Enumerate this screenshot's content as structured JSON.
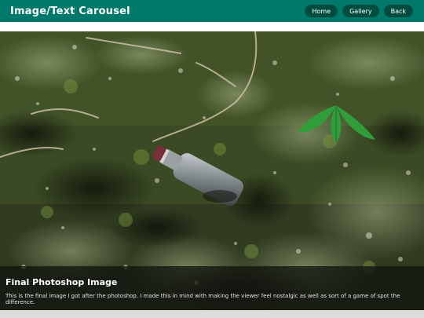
{
  "header": {
    "title": "Image/Text Carousel",
    "nav": [
      {
        "label": "Home"
      },
      {
        "label": "Gallery"
      },
      {
        "label": "Back"
      }
    ]
  },
  "slide": {
    "heading": "Final Photoshop Image",
    "description": "This is the final image I got after the photoshop. I made this in mind with making the viewer feel nostalgic as well as sort of a game of spot the difference."
  },
  "colors": {
    "header_bg": "#00796b",
    "nav_button_bg": "#004d40",
    "leaf_green": "#2f9e3a"
  }
}
